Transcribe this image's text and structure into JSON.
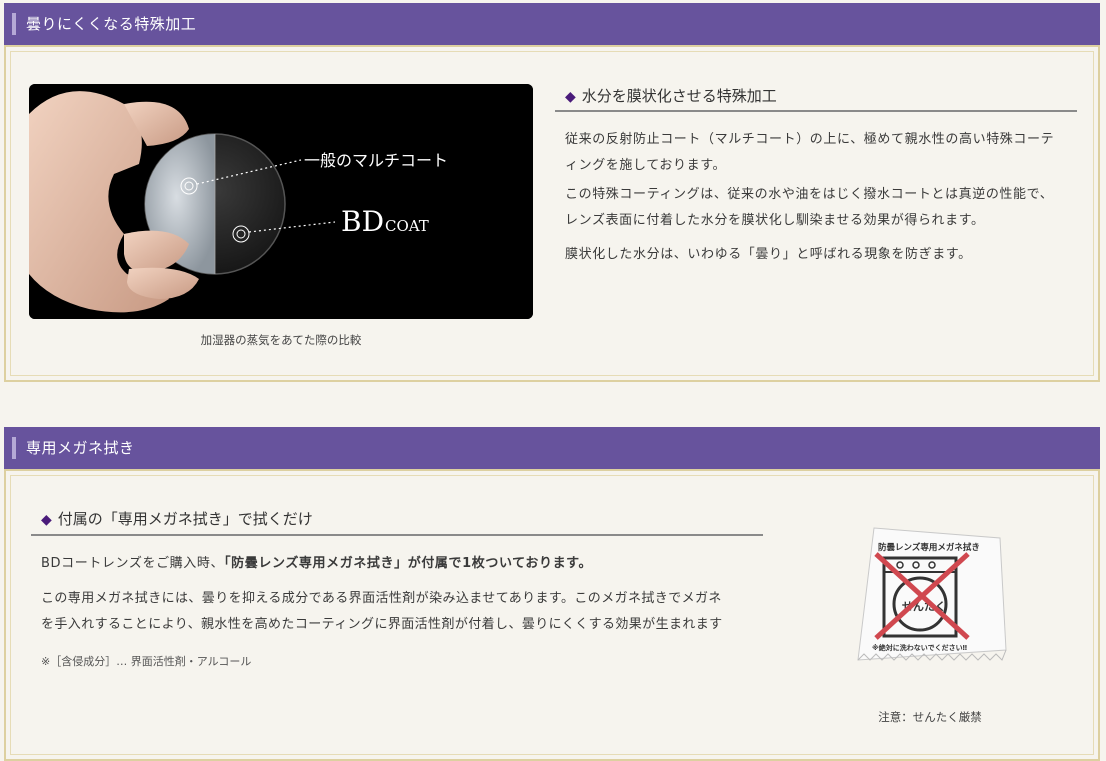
{
  "section1": {
    "header": "曇りにくくなる特殊加工",
    "photo": {
      "label_multi": "一般のマルチコート",
      "label_bd_big": "BD",
      "label_bd_small": "COAT"
    },
    "caption": "加湿器の蒸気をあてた際の比較",
    "subhead": "水分を膜状化させる特殊加工",
    "diamond": "◆",
    "para1_line1": "従来の反射防止コート（マルチコート）の上に、極めて親水性の高い特殊コーテ",
    "para1_line2": "ィングを施しております。",
    "para2_line1": "この特殊コーティングは、従来の水や油をはじく撥水コートとは真逆の性能で、",
    "para2_line2": "レンズ表面に付着した水分を膜状化し馴染ませる効果が得られます。",
    "para3": "膜状化した水分は、いわゆる「曇り」と呼ばれる現象を防ぎます。"
  },
  "section2": {
    "header": "専用メガネ拭き",
    "subhead": "付属の「専用メガネ拭き」で拭くだけ",
    "diamond": "◆",
    "para1_prefix": "BDコートレンズをご購入時、",
    "para1_bold": "「防曇レンズ専用メガネ拭き」が付属で1枚ついております。",
    "para2_line1": "この専用メガネ拭きには、曇りを抑える成分である界面活性剤が染み込ませてあります。このメガネ拭きでメガネ",
    "para2_line2": "を手入れすることにより、親水性を高めたコーティングに界面活性剤が付着し、曇りにくくする効果が生まれます",
    "note": "※［含侵成分］… 界面活性剤・アルコール",
    "cloth": {
      "top_label": "防曇レンズ専用メガネ拭き",
      "center_label": "せんたく",
      "bottom_label": "※絶対に洗わないでください‼"
    },
    "cloth_caption": "注意：せんたく厳禁"
  },
  "colors": {
    "header_bg": "#67539d",
    "page_bg": "#f6f4ee",
    "panel_border": "#ddd0a0",
    "diamond": "#4a1b7a"
  }
}
